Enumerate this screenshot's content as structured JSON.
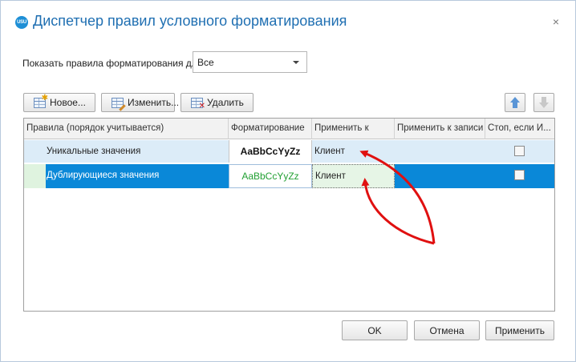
{
  "window": {
    "title": "Диспетчер правил условного форматирования",
    "logo_text": "USU",
    "close_glyph": "×",
    "icons": {
      "app": "usu-logo-icon",
      "close": "close-icon"
    }
  },
  "filter": {
    "label": "Показать правила форматирования для:",
    "selected": "Все"
  },
  "toolbar": {
    "new_label": "Новое...",
    "edit_label": "Изменить...",
    "delete_label": "Удалить",
    "icons": {
      "new": "new-rule-icon",
      "edit": "edit-rule-icon",
      "delete": "delete-rule-icon",
      "up": "move-up-icon",
      "down": "move-down-icon"
    }
  },
  "grid": {
    "columns": [
      "Правила (порядок учитывается)",
      "Форматирование",
      "Применить к",
      "Применить к записи",
      "Стоп, если И..."
    ],
    "rows": [
      {
        "rule": "Уникальные значения",
        "format_preview": "AaBbCcYyZz",
        "apply_to": "Клиент",
        "apply_to_record": "",
        "stop_if_true": false,
        "selected": false
      },
      {
        "rule": "Дублирующиеся значения",
        "format_preview": "AaBbCcYyZz",
        "apply_to": "Клиент",
        "apply_to_record": "",
        "stop_if_true": false,
        "selected": true
      }
    ]
  },
  "footer": {
    "ok_label": "OK",
    "cancel_label": "Отмена",
    "apply_label": "Применить"
  },
  "colors": {
    "title": "#1f6fb2",
    "selected_row": "#0a88d8",
    "unique_row": "#dcecf8",
    "duplicate_format": "#22a033",
    "annotation_arrow": "#e01010"
  }
}
